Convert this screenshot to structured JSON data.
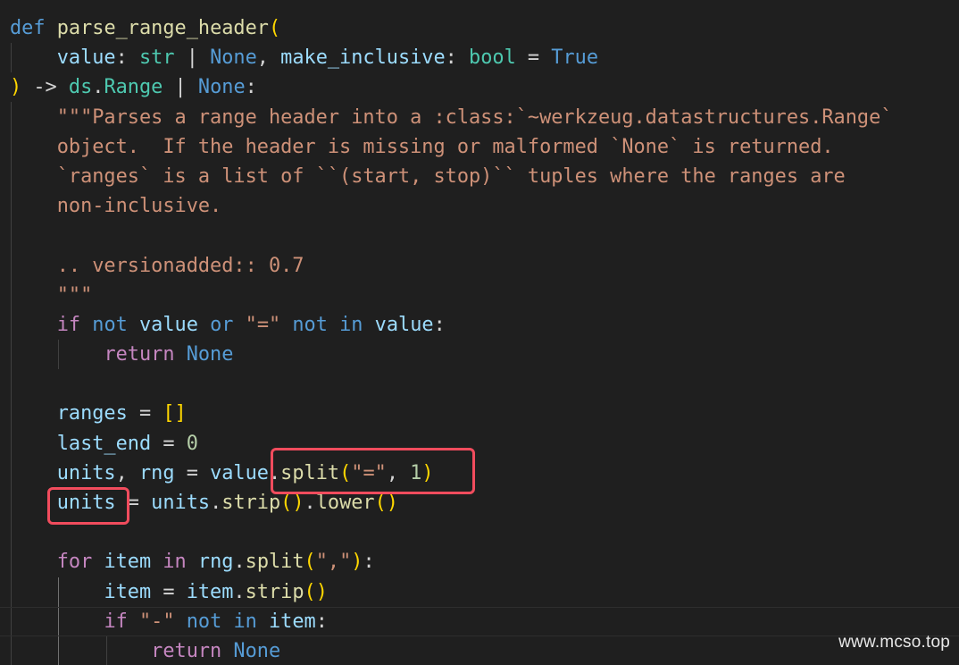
{
  "editor": {
    "language": "python",
    "theme_colors": {
      "background": "#1f1f1f",
      "keyword": "#569cd6",
      "control": "#c586c0",
      "function": "#dcdcaa",
      "variable": "#9cdcfe",
      "type": "#4ec9b0",
      "string": "#ce9178",
      "number": "#b5cea8",
      "bracket_level1": "#ffd700",
      "bracket_level2": "#da70d6",
      "annotation_box": "#f14c5d"
    },
    "lines": [
      [
        [
          "def",
          "kw-def"
        ],
        [
          " ",
          "pn"
        ],
        [
          "parse_range_header",
          "fn"
        ],
        [
          "(",
          "br1"
        ]
      ],
      [
        [
          "    ",
          "pn"
        ],
        [
          "value",
          "var"
        ],
        [
          ": ",
          "pn"
        ],
        [
          "str",
          "type"
        ],
        [
          " | ",
          "pn"
        ],
        [
          "None",
          "const"
        ],
        [
          ", ",
          "pn"
        ],
        [
          "make_inclusive",
          "var"
        ],
        [
          ": ",
          "pn"
        ],
        [
          "bool",
          "type"
        ],
        [
          " = ",
          "op"
        ],
        [
          "True",
          "const"
        ]
      ],
      [
        [
          ")",
          "br1"
        ],
        [
          " -> ",
          "pn"
        ],
        [
          "ds",
          "type"
        ],
        [
          ".",
          "pn"
        ],
        [
          "Range",
          "type"
        ],
        [
          " | ",
          "pn"
        ],
        [
          "None",
          "const"
        ],
        [
          ":",
          "pn"
        ]
      ],
      [
        [
          "    ",
          "pn"
        ],
        [
          "\"\"\"Parses a range header into a :class:`~werkzeug.datastructures.Range`",
          "str"
        ]
      ],
      [
        [
          "    ",
          "pn"
        ],
        [
          "object.  If the header is missing or malformed `None` is returned.",
          "str"
        ]
      ],
      [
        [
          "    ",
          "pn"
        ],
        [
          "`ranges` is a list of ``(start, stop)`` tuples where the ranges are",
          "str"
        ]
      ],
      [
        [
          "    ",
          "pn"
        ],
        [
          "non-inclusive.",
          "str"
        ]
      ],
      [
        [
          "",
          "pn"
        ]
      ],
      [
        [
          "    ",
          "pn"
        ],
        [
          ".. versionadded:: 0.7",
          "str"
        ]
      ],
      [
        [
          "    ",
          "pn"
        ],
        [
          "\"\"\"",
          "str"
        ]
      ],
      [
        [
          "    ",
          "pn"
        ],
        [
          "if",
          "kw-ctl"
        ],
        [
          " ",
          "pn"
        ],
        [
          "not",
          "kw-op"
        ],
        [
          " ",
          "pn"
        ],
        [
          "value",
          "var"
        ],
        [
          " ",
          "pn"
        ],
        [
          "or",
          "kw-op"
        ],
        [
          " ",
          "pn"
        ],
        [
          "\"=\"",
          "str"
        ],
        [
          " ",
          "pn"
        ],
        [
          "not",
          "kw-op"
        ],
        [
          " ",
          "pn"
        ],
        [
          "in",
          "kw-op"
        ],
        [
          " ",
          "pn"
        ],
        [
          "value",
          "var"
        ],
        [
          ":",
          "pn"
        ]
      ],
      [
        [
          "        ",
          "pn"
        ],
        [
          "return",
          "kw-ctl"
        ],
        [
          " ",
          "pn"
        ],
        [
          "None",
          "const"
        ]
      ],
      [
        [
          "",
          "pn"
        ]
      ],
      [
        [
          "    ",
          "pn"
        ],
        [
          "ranges",
          "var"
        ],
        [
          " = ",
          "op"
        ],
        [
          "[]",
          "br1"
        ]
      ],
      [
        [
          "    ",
          "pn"
        ],
        [
          "last_end",
          "var"
        ],
        [
          " = ",
          "op"
        ],
        [
          "0",
          "num"
        ]
      ],
      [
        [
          "    ",
          "pn"
        ],
        [
          "units",
          "var"
        ],
        [
          ", ",
          "pn"
        ],
        [
          "rng",
          "var"
        ],
        [
          " = ",
          "op"
        ],
        [
          "value",
          "var"
        ],
        [
          ".",
          "pn"
        ],
        [
          "split",
          "fn"
        ],
        [
          "(",
          "br1"
        ],
        [
          "\"=\"",
          "str"
        ],
        [
          ", ",
          "pn"
        ],
        [
          "1",
          "num"
        ],
        [
          ")",
          "br1"
        ]
      ],
      [
        [
          "    ",
          "pn"
        ],
        [
          "units",
          "var"
        ],
        [
          " = ",
          "op"
        ],
        [
          "units",
          "var"
        ],
        [
          ".",
          "pn"
        ],
        [
          "strip",
          "fn"
        ],
        [
          "()",
          "br1"
        ],
        [
          ".",
          "pn"
        ],
        [
          "lower",
          "fn"
        ],
        [
          "()",
          "br1"
        ]
      ],
      [
        [
          "",
          "pn"
        ]
      ],
      [
        [
          "    ",
          "pn"
        ],
        [
          "for",
          "kw-ctl"
        ],
        [
          " ",
          "pn"
        ],
        [
          "item",
          "var"
        ],
        [
          " ",
          "pn"
        ],
        [
          "in",
          "kw-ctl"
        ],
        [
          " ",
          "pn"
        ],
        [
          "rng",
          "var"
        ],
        [
          ".",
          "pn"
        ],
        [
          "split",
          "fn"
        ],
        [
          "(",
          "br1"
        ],
        [
          "\",\"",
          "str"
        ],
        [
          ")",
          "br1"
        ],
        [
          ":",
          "pn"
        ]
      ],
      [
        [
          "        ",
          "pn"
        ],
        [
          "item",
          "var"
        ],
        [
          " = ",
          "op"
        ],
        [
          "item",
          "var"
        ],
        [
          ".",
          "pn"
        ],
        [
          "strip",
          "fn"
        ],
        [
          "()",
          "br1"
        ]
      ],
      [
        [
          "        ",
          "pn"
        ],
        [
          "if",
          "kw-ctl"
        ],
        [
          " ",
          "pn"
        ],
        [
          "\"-\"",
          "str"
        ],
        [
          " ",
          "pn"
        ],
        [
          "not",
          "kw-op"
        ],
        [
          " ",
          "pn"
        ],
        [
          "in",
          "kw-op"
        ],
        [
          " ",
          "pn"
        ],
        [
          "item",
          "var"
        ],
        [
          ":",
          "pn"
        ]
      ],
      [
        [
          "            ",
          "pn"
        ],
        [
          "return",
          "kw-ctl"
        ],
        [
          " ",
          "pn"
        ],
        [
          "None",
          "const"
        ]
      ]
    ]
  },
  "watermark": "www.mcso.top"
}
